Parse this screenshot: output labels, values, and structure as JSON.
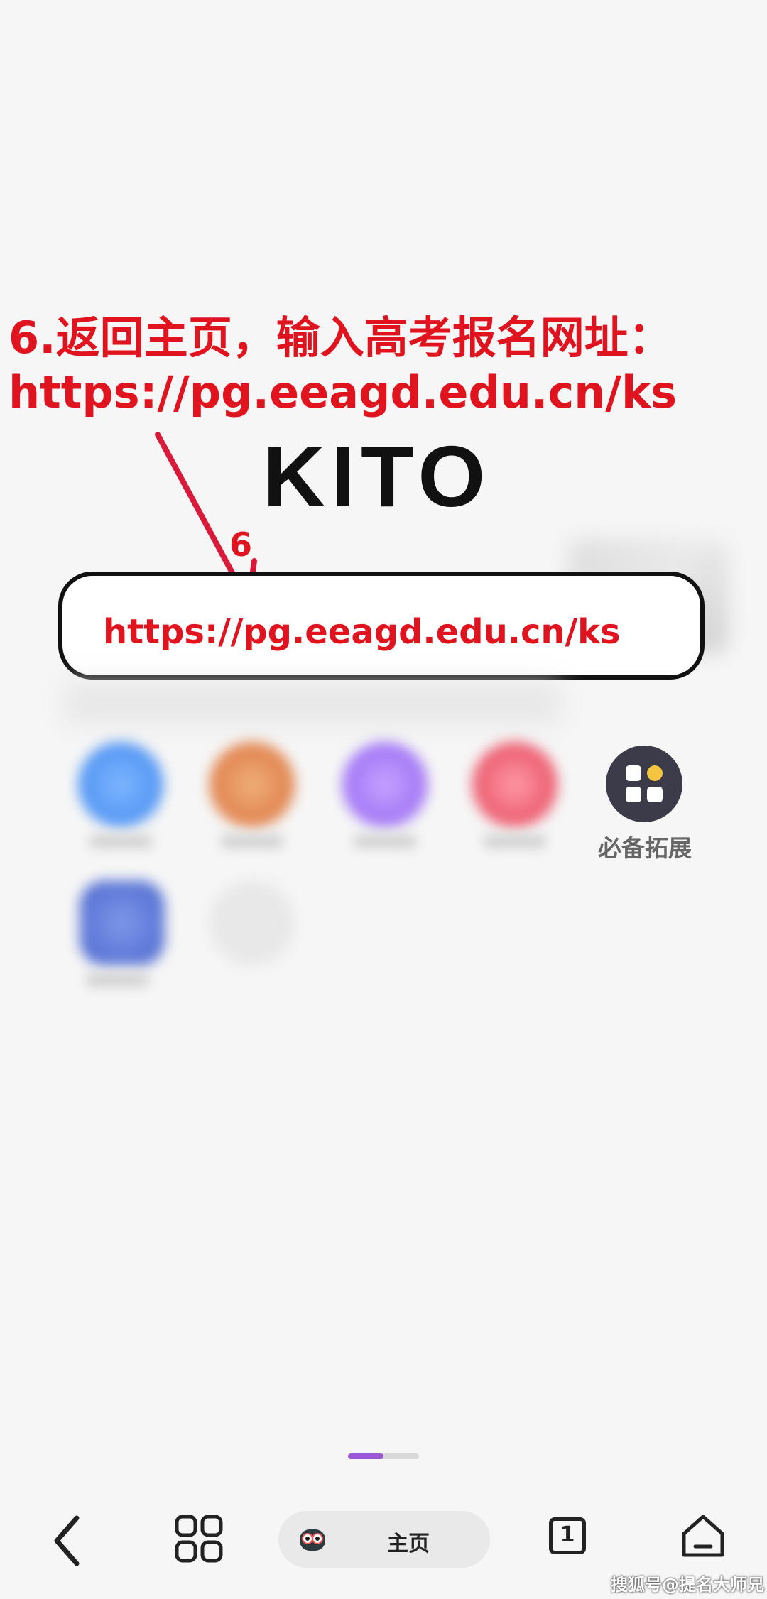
{
  "annotation": {
    "line1": "6.返回主页，输入高考报名网址：",
    "line2": "https://pg.eeagd.edu.cn/ks",
    "step_number": "6",
    "color": "#e0141f"
  },
  "logo": {
    "text": "KITO"
  },
  "search": {
    "value": "https://pg.eeagd.edu.cn/ks"
  },
  "shortcuts": {
    "extension": {
      "label": "必备拓展"
    }
  },
  "bottom_nav": {
    "home_label": "主页",
    "tab_count": "1"
  },
  "watermark": "搜狐号@提名大师兄",
  "colors": {
    "accent": "#9b59d6"
  }
}
